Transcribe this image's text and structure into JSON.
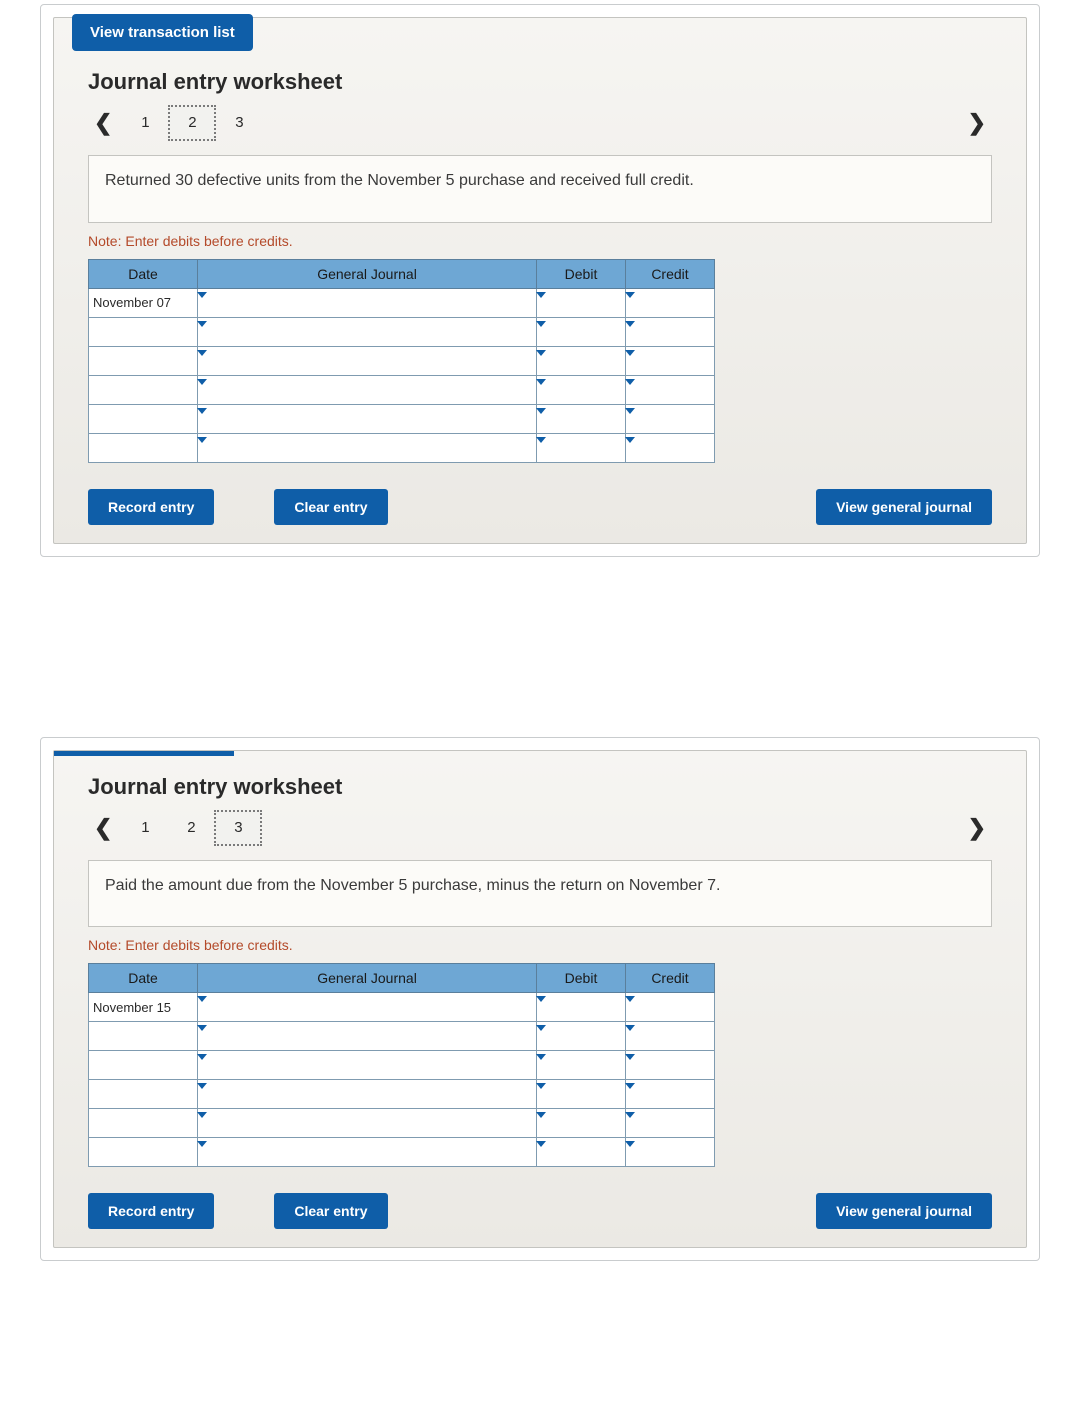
{
  "common": {
    "view_transaction_list": "View transaction list",
    "ws_title": "Journal entry worksheet",
    "note": "Note: Enter debits before credits.",
    "headers": {
      "date": "Date",
      "gj": "General Journal",
      "debit": "Debit",
      "credit": "Credit"
    },
    "buttons": {
      "record": "Record entry",
      "clear": "Clear entry",
      "view_gj": "View general journal"
    },
    "pages": [
      "1",
      "2",
      "3"
    ]
  },
  "ws1": {
    "active_page_index": 1,
    "description": "Returned 30 defective units from the November 5 purchase and received full credit.",
    "rows": [
      {
        "date": "November 07",
        "gj": "",
        "debit": "",
        "credit": ""
      },
      {
        "date": "",
        "gj": "",
        "debit": "",
        "credit": ""
      },
      {
        "date": "",
        "gj": "",
        "debit": "",
        "credit": ""
      },
      {
        "date": "",
        "gj": "",
        "debit": "",
        "credit": ""
      },
      {
        "date": "",
        "gj": "",
        "debit": "",
        "credit": ""
      },
      {
        "date": "",
        "gj": "",
        "debit": "",
        "credit": ""
      }
    ]
  },
  "ws2": {
    "active_page_index": 2,
    "description": "Paid the amount due from the November 5 purchase, minus the return on November 7.",
    "rows": [
      {
        "date": "November 15",
        "gj": "",
        "debit": "",
        "credit": ""
      },
      {
        "date": "",
        "gj": "",
        "debit": "",
        "credit": ""
      },
      {
        "date": "",
        "gj": "",
        "debit": "",
        "credit": ""
      },
      {
        "date": "",
        "gj": "",
        "debit": "",
        "credit": ""
      },
      {
        "date": "",
        "gj": "",
        "debit": "",
        "credit": ""
      },
      {
        "date": "",
        "gj": "",
        "debit": "",
        "credit": ""
      }
    ]
  }
}
